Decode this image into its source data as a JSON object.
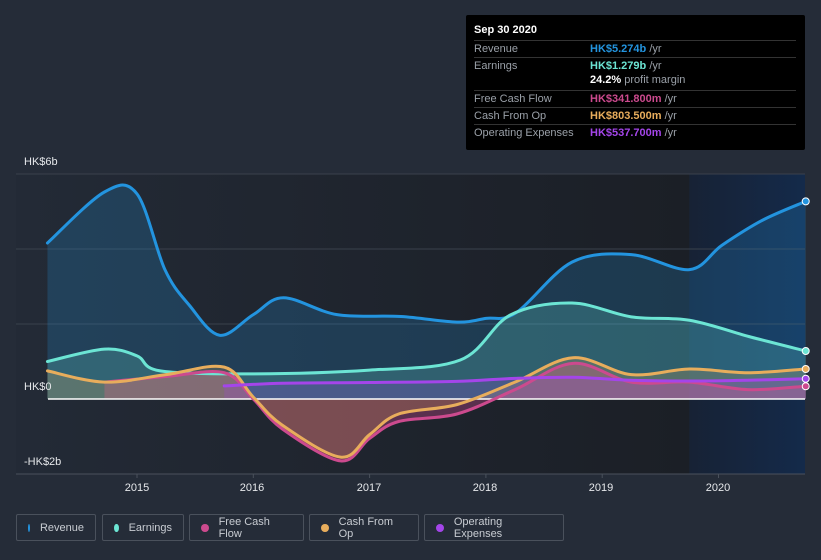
{
  "tooltip": {
    "date": "Sep 30 2020",
    "rows": [
      {
        "label": "Revenue",
        "value": "HK$5.274b",
        "unit": " /yr",
        "color": "#2394df"
      },
      {
        "label": "Earnings",
        "value": "HK$1.279b",
        "unit": " /yr",
        "color": "#6ce5d4"
      },
      {
        "label": "Free Cash Flow",
        "value": "HK$341.800m",
        "unit": " /yr",
        "color": "#cc4a8e"
      },
      {
        "label": "Cash From Op",
        "value": "HK$803.500m",
        "unit": " /yr",
        "color": "#e8ad5c"
      },
      {
        "label": "Operating Expenses",
        "value": "HK$537.700m",
        "unit": " /yr",
        "color": "#a445ea"
      }
    ],
    "profit_margin_value": "24.2%",
    "profit_margin_label": " profit margin"
  },
  "legend": [
    {
      "label": "Revenue",
      "color": "#2394df"
    },
    {
      "label": "Earnings",
      "color": "#6ce5d4"
    },
    {
      "label": "Free Cash Flow",
      "color": "#cc4a8e"
    },
    {
      "label": "Cash From Op",
      "color": "#e8ad5c"
    },
    {
      "label": "Operating Expenses",
      "color": "#a445ea"
    }
  ],
  "chart_data": {
    "type": "area",
    "title": "",
    "xlabel": "",
    "ylabel": "",
    "y_unit": "HK$ billions",
    "ylim": [
      -2,
      6
    ],
    "xlim": [
      2014.23,
      2020.75
    ],
    "y_tick_labels": [
      {
        "value": 6,
        "label": "HK$6b"
      },
      {
        "value": 0,
        "label": "HK$0"
      },
      {
        "value": -2,
        "label": "-HK$2b"
      }
    ],
    "y_gridlines": [
      6,
      4,
      2
    ],
    "x_ticks": [
      {
        "value": 2015,
        "label": "2015"
      },
      {
        "value": 2016,
        "label": "2016"
      },
      {
        "value": 2017,
        "label": "2017"
      },
      {
        "value": 2018,
        "label": "2018"
      },
      {
        "value": 2019,
        "label": "2019"
      },
      {
        "value": 2020,
        "label": "2020"
      }
    ],
    "highlight_from": 2019.75,
    "series": [
      {
        "name": "Revenue",
        "color": "#2394df",
        "x": [
          2014.23,
          2014.72,
          2015.0,
          2015.24,
          2015.45,
          2015.71,
          2016.0,
          2016.26,
          2016.72,
          2017.27,
          2017.75,
          2018.0,
          2018.26,
          2018.74,
          2019.25,
          2019.75,
          2020.03,
          2020.38,
          2020.75
        ],
        "values": [
          4.16,
          5.52,
          5.47,
          3.45,
          2.5,
          1.7,
          2.25,
          2.7,
          2.25,
          2.2,
          2.05,
          2.15,
          2.3,
          3.65,
          3.85,
          3.45,
          4.1,
          4.77,
          5.27
        ]
      },
      {
        "name": "Earnings",
        "color": "#6ce5d4",
        "x": [
          2014.23,
          2014.72,
          2015.0,
          2015.2,
          2016.0,
          2017.0,
          2017.78,
          2018.21,
          2018.74,
          2019.25,
          2019.75,
          2020.28,
          2020.75
        ],
        "values": [
          1.0,
          1.33,
          1.15,
          0.75,
          0.67,
          0.77,
          1.04,
          2.24,
          2.56,
          2.19,
          2.1,
          1.65,
          1.28
        ]
      },
      {
        "name": "Free Cash Flow",
        "color": "#cc4a8e",
        "x": [
          2014.72,
          2015.25,
          2015.75,
          2016.0,
          2016.25,
          2016.75,
          2017.0,
          2017.25,
          2017.75,
          2018.25,
          2018.75,
          2019.25,
          2019.75,
          2020.25,
          2020.75
        ],
        "values": [
          0.45,
          0.6,
          0.7,
          0.0,
          -0.8,
          -1.65,
          -1.05,
          -0.6,
          -0.4,
          0.25,
          0.95,
          0.45,
          0.45,
          0.25,
          0.34
        ]
      },
      {
        "name": "Cash From Op",
        "color": "#e8ad5c",
        "x": [
          2014.23,
          2014.72,
          2015.25,
          2015.75,
          2016.0,
          2016.25,
          2016.75,
          2017.0,
          2017.25,
          2017.75,
          2018.25,
          2018.75,
          2019.25,
          2019.75,
          2020.25,
          2020.75
        ],
        "values": [
          0.75,
          0.45,
          0.65,
          0.85,
          0.05,
          -0.7,
          -1.55,
          -0.95,
          -0.4,
          -0.15,
          0.45,
          1.1,
          0.65,
          0.8,
          0.7,
          0.8
        ]
      },
      {
        "name": "Operating Expenses",
        "color": "#a445ea",
        "x": [
          2015.75,
          2016.25,
          2017.0,
          2017.75,
          2018.25,
          2018.75,
          2019.25,
          2019.75,
          2020.25,
          2020.75
        ],
        "values": [
          0.35,
          0.42,
          0.44,
          0.47,
          0.55,
          0.58,
          0.5,
          0.48,
          0.5,
          0.54
        ]
      }
    ]
  }
}
